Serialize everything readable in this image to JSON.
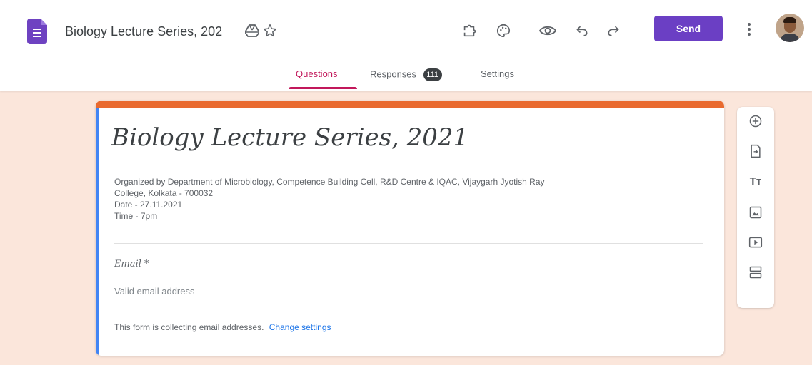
{
  "header": {
    "doc_title": "Biology Lecture Series, 202",
    "send_label": "Send",
    "icons": [
      "forms-app-icon",
      "move-to-drive-icon",
      "star-icon",
      "add-ons-icon",
      "customize-theme-icon",
      "preview-icon",
      "undo-icon",
      "redo-icon",
      "more-vert-icon",
      "avatar"
    ]
  },
  "tabs": {
    "questions": "Questions",
    "responses": "Responses",
    "responses_count": "111",
    "settings": "Settings"
  },
  "form": {
    "title": "Biology Lecture Series, 2021",
    "description_lines": [
      "Organized by Department of Microbiology, Competence Building Cell, R&D Centre & IQAC, Vijaygarh Jyotish Ray",
      "College, Kolkata - 700032",
      "Date - 27.11.2021",
      "Time - 7pm"
    ],
    "email_label": "Email *",
    "email_placeholder": "Valid email address",
    "notice": "This form is collecting email addresses.",
    "change_settings": "Change settings"
  },
  "side_toolbar": {
    "tools": [
      "add-question-icon",
      "import-questions-icon",
      "add-title-icon",
      "add-image-icon",
      "add-video-icon",
      "add-section-icon"
    ],
    "title_glyph": "Tт"
  },
  "colors": {
    "page_bg": "#fbe6db",
    "accent_purple": "#6b3fc4",
    "card_top": "#e96a2f",
    "card_left": "#4285f4",
    "tab_active": "#c2185b"
  }
}
